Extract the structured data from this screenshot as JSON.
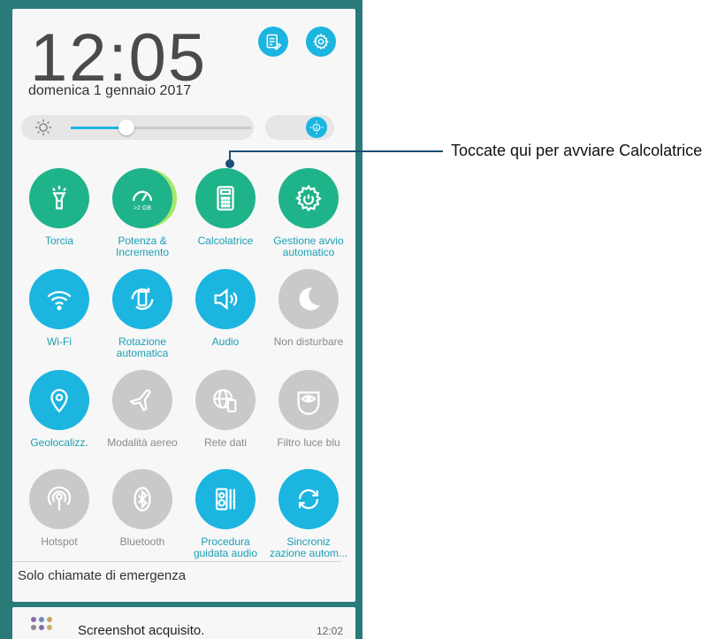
{
  "header": {
    "time": "12:05",
    "date": "domenica 1 gennaio 2017",
    "edit_icon": "edit-list-icon",
    "settings_icon": "gear-icon"
  },
  "brightness": {
    "level_fraction": 0.3,
    "sun_icon": "brightness-icon",
    "auto_icon": "auto-brightness-icon"
  },
  "tiles": [
    {
      "label": "Torcia",
      "icon": "flashlight-icon",
      "state": "on",
      "color": "#1fb38a"
    },
    {
      "label": "Potenza &\nIncremento",
      "icon": "speedometer-icon",
      "badge": ">2 GB",
      "state": "on",
      "color": "#1fb38a"
    },
    {
      "label": "Calcolatrice",
      "icon": "calculator-icon",
      "state": "on",
      "color": "#1fb38a"
    },
    {
      "label": "Gestione avvio\nautomatico",
      "icon": "gear-power-icon",
      "state": "on",
      "color": "#1fb38a"
    },
    {
      "label": "Wi-Fi",
      "icon": "wifi-icon",
      "state": "on",
      "color": "#1bb5e0"
    },
    {
      "label": "Rotazione\nautomatica",
      "icon": "rotate-icon",
      "state": "on",
      "color": "#1bb5e0"
    },
    {
      "label": "Audio",
      "icon": "speaker-icon",
      "state": "on",
      "color": "#1bb5e0"
    },
    {
      "label": "Non disturbare",
      "icon": "moon-icon",
      "state": "off",
      "color": "#c9c9c9"
    },
    {
      "label": "Geolocalizz.",
      "icon": "location-pin-icon",
      "state": "on",
      "color": "#1bb5e0"
    },
    {
      "label": "Modalità aereo",
      "icon": "airplane-icon",
      "state": "off",
      "color": "#c9c9c9"
    },
    {
      "label": "Rete dati",
      "icon": "globe-phone-icon",
      "state": "off",
      "color": "#c9c9c9"
    },
    {
      "label": "Filtro luce blu",
      "icon": "eye-filter-icon",
      "state": "off",
      "color": "#c9c9c9"
    },
    {
      "label": "Hotspot",
      "icon": "hotspot-icon",
      "state": "off",
      "color": "#c9c9c9"
    },
    {
      "label": "Bluetooth",
      "icon": "bluetooth-icon",
      "state": "off",
      "color": "#c9c9c9"
    },
    {
      "label": "Procedura\nguidata audio",
      "icon": "audio-wizard-icon",
      "state": "on",
      "color": "#1bb5e0"
    },
    {
      "label": "Sincroniz\nzazione autom...",
      "icon": "sync-icon",
      "state": "on",
      "color": "#1bb5e0"
    }
  ],
  "footer": {
    "emergency_text": "Solo chiamate di emergenza"
  },
  "notification": {
    "icon": "app-grid-icon",
    "text": "Screenshot acquisito.",
    "time": "12:02"
  },
  "callout": {
    "text": "Toccate qui per avviare Calcolatrice"
  },
  "colors": {
    "accent_blue": "#1bb5e0",
    "accent_green": "#1fb38a",
    "inactive_grey": "#c9c9c9",
    "callout_line": "#1b4f75"
  }
}
